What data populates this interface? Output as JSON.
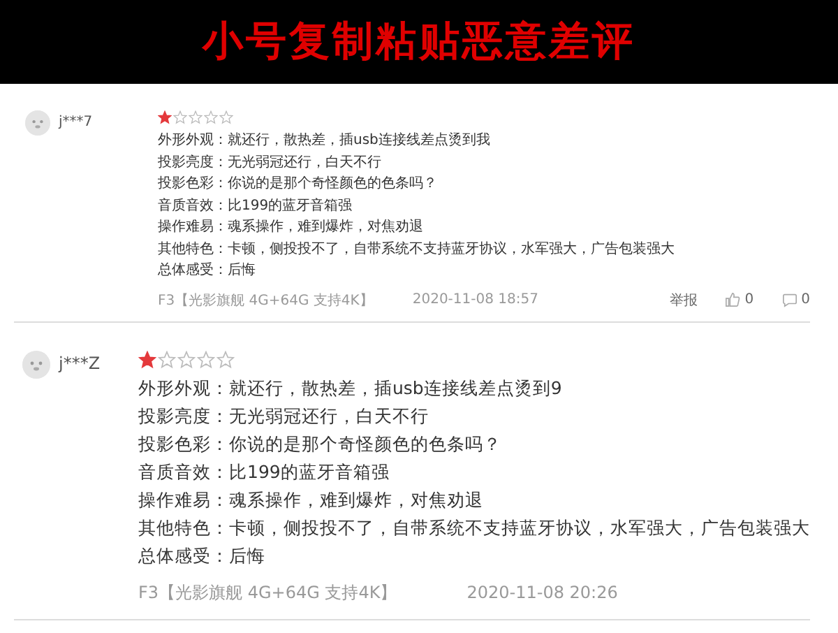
{
  "banner": {
    "title": "小号复制粘贴恶意差评"
  },
  "reviews": [
    {
      "kind": "small",
      "user": "j***7",
      "stars": 1,
      "lines": [
        "外形外观：就还行，散热差，插usb连接线差点烫到我",
        "投影亮度：无光弱冠还行，白天不行",
        "投影色彩：你说的是那个奇怪颜色的色条吗？",
        "音质音效：比199的蓝牙音箱强",
        "操作难易：魂系操作，难到爆炸，对焦劝退",
        "其他特色：卡顿，侧投投不了，自带系统不支持蓝牙协议，水军强大，广告包装强大",
        "总体感受：后悔"
      ],
      "spec": "F3【光影旗舰 4G+64G 支持4K】",
      "date": "2020-11-08 18:57",
      "report": "举报",
      "likes": "0",
      "comments": "0"
    },
    {
      "kind": "large",
      "user": "j***Z",
      "stars": 1,
      "lines": [
        "外形外观：就还行，散热差，插usb连接线差点烫到9",
        "投影亮度：无光弱冠还行，白天不行",
        "投影色彩：你说的是那个奇怪颜色的色条吗？",
        "音质音效：比199的蓝牙音箱强",
        "操作难易：魂系操作，难到爆炸，对焦劝退",
        "其他特色：卡顿，侧投投不了，自带系统不支持蓝牙协议，水军强大，广告包装强大",
        "总体感受：后悔"
      ],
      "spec": "F3【光影旗舰 4G+64G 支持4K】",
      "date": "2020-11-08 20:26"
    }
  ]
}
